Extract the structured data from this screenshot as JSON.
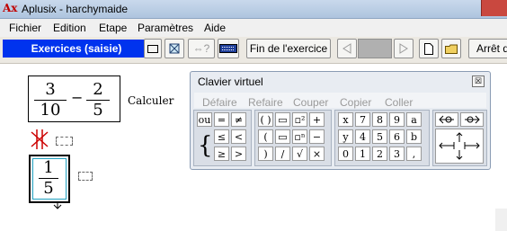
{
  "window": {
    "title": "Aplusix - harchymaide",
    "icon_label": "Ax"
  },
  "menu": [
    "Fichier",
    "Edition",
    "Etape",
    "Paramètres",
    "Aide"
  ],
  "toolbar": {
    "mode_label": "Exercices (saisie)",
    "end_exercise_label": "Fin de l'exercice",
    "stop_label": "Arrêt d",
    "equiv_label": "⇔?"
  },
  "work": {
    "expr_num1": "3",
    "expr_den1": "10",
    "expr_op": "−",
    "expr_num2": "2",
    "expr_den2": "5",
    "instruction": "Calculer",
    "answer_num": "1",
    "answer_den": "5"
  },
  "keyboard": {
    "title": "Clavier virtuel",
    "close": "☒",
    "menu": [
      "Défaire",
      "Refaire",
      "Couper",
      "Copier",
      "Coller"
    ],
    "logic_rows": [
      [
        "ou",
        "=",
        "≠"
      ],
      [
        "≤",
        "<"
      ],
      [
        "≥",
        ">"
      ]
    ],
    "brace": "{",
    "struct_rows": [
      [
        "( )",
        "▭",
        "▫²",
        "+"
      ],
      [
        "(",
        "▭",
        "▫ⁿ",
        "−"
      ],
      [
        ")",
        "/",
        "√",
        "×"
      ]
    ],
    "digit_rows": [
      [
        "x",
        "7",
        "8",
        "9",
        "a"
      ],
      [
        "y",
        "4",
        "5",
        "6",
        "b"
      ],
      [
        "0",
        "1",
        "2",
        "3",
        ","
      ]
    ]
  }
}
